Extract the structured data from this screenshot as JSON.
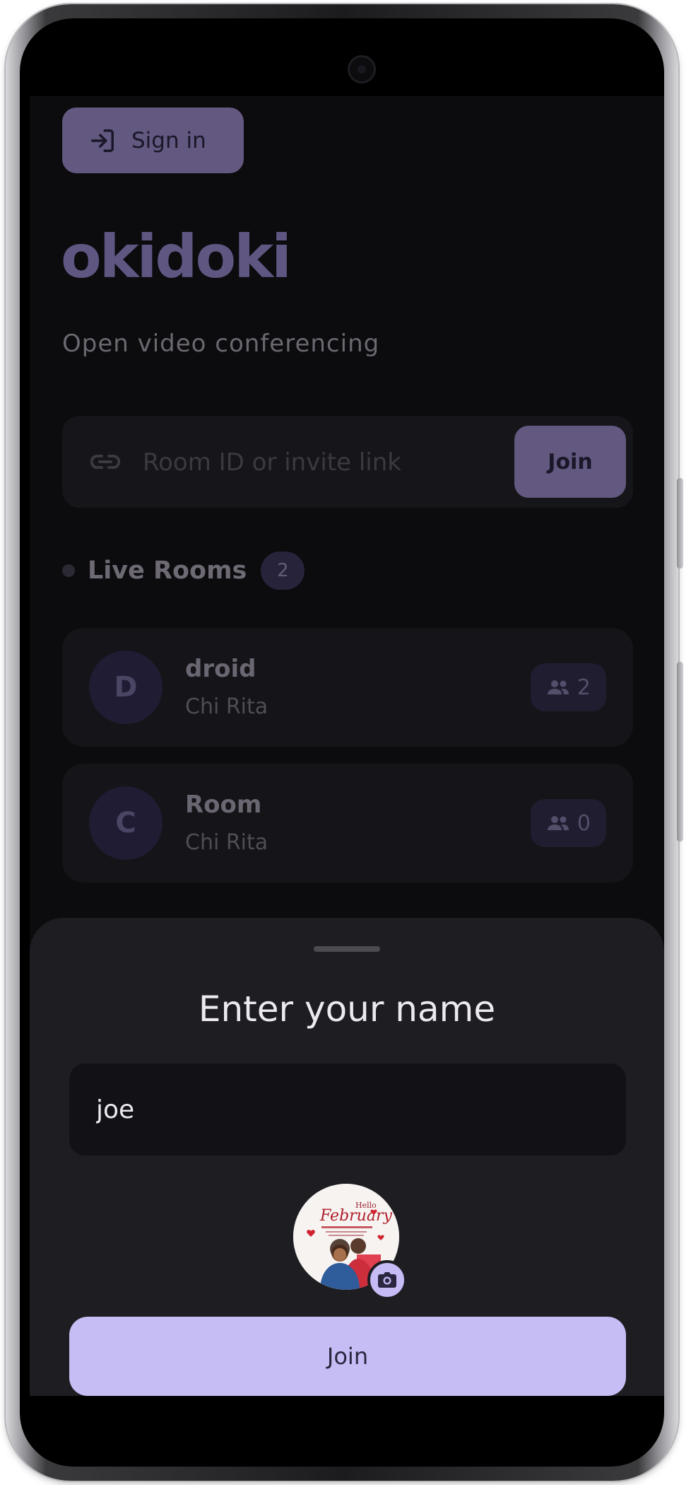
{
  "header": {
    "sign_in_label": "Sign in"
  },
  "brand": {
    "name": "okidoki",
    "tagline": "Open video conferencing"
  },
  "room_entry": {
    "placeholder": "Room ID or invite link",
    "join_label": "Join"
  },
  "live_rooms": {
    "title": "Live Rooms",
    "count": "2",
    "rooms": [
      {
        "initial": "D",
        "name": "droid",
        "owner": "Chi Rita",
        "members": "2"
      },
      {
        "initial": "C",
        "name": "Room",
        "owner": "Chi Rita",
        "members": "0"
      }
    ]
  },
  "name_sheet": {
    "title": "Enter your name",
    "name_value": "joe",
    "photo_text": {
      "greeting": "Hello",
      "month": "February"
    },
    "join_label": "Join"
  },
  "colors": {
    "accent": "#c7bdf5",
    "accent_dim": "#625880",
    "background": "#0c0b0e",
    "sheet": "#1e1d22"
  },
  "icons": {
    "sign_in": "login-icon",
    "link": "link-icon",
    "members": "people-icon",
    "camera": "camera-icon"
  }
}
